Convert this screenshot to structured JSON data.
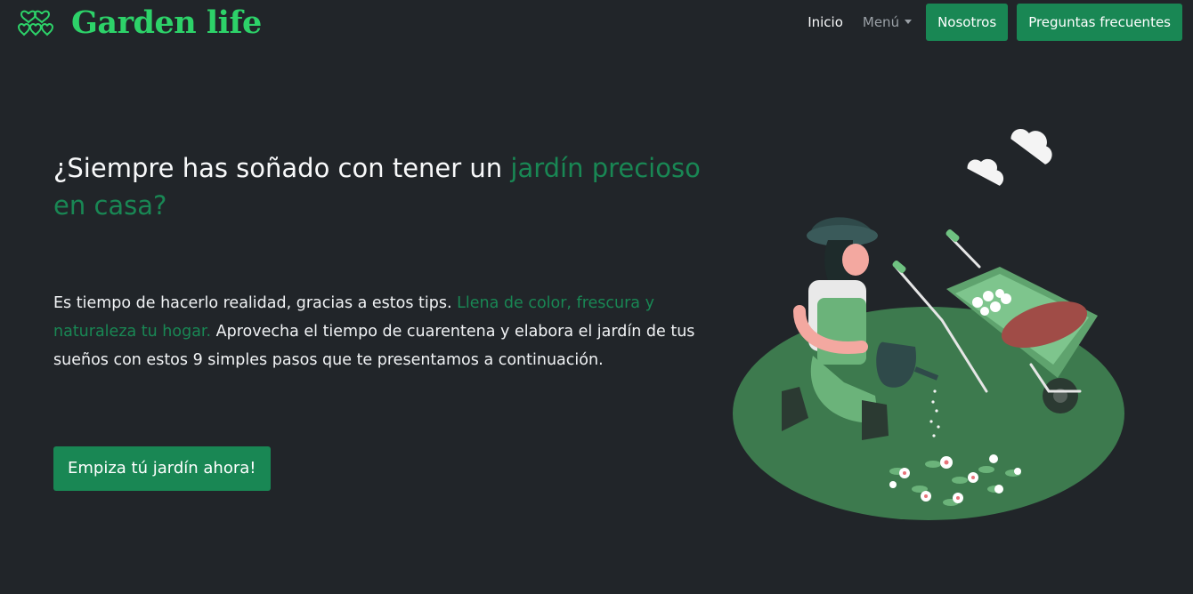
{
  "brand": {
    "name": "Garden life",
    "logo_icon": "hearts-icon",
    "color": "#2dd269"
  },
  "nav": {
    "home_label": "Inicio",
    "menu_label": "Menú",
    "about_label": "Nosotros",
    "faq_label": "Preguntas frecuentes"
  },
  "hero": {
    "headline_prefix": "¿Siempre has soñado con tener un ",
    "headline_highlight": "jardín precioso en casa?",
    "lead_prefix": "Es tiempo de hacerlo realidad, gracias a estos tips. ",
    "lead_highlight": "Llena de color, frescura y naturaleza tu hogar.",
    "lead_suffix": " Aprovecha el tiempo de cuarentena y elabora el jardín de tus sueños con estos 9 simples pasos que te presentamos a continuación.",
    "cta_label": "Empiza tú jardín ahora!"
  },
  "colors": {
    "background": "#212529",
    "accent": "#198754",
    "text": "#f8f9fa"
  },
  "illustration": {
    "icon": "gardener-watering-plants-illustration"
  }
}
